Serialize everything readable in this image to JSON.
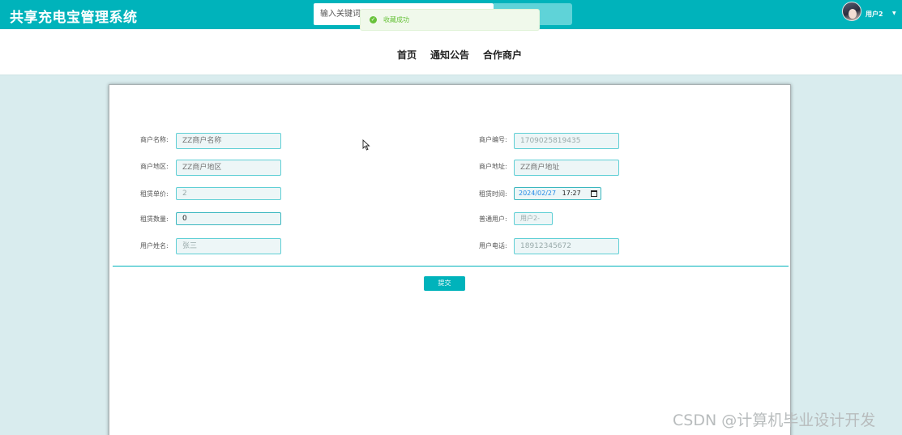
{
  "header": {
    "app_title": "共享充电宝管理系统",
    "search_placeholder": "输入关键词",
    "user_name": "用户2",
    "toast_message": "收藏成功"
  },
  "nav": {
    "items": [
      {
        "label": "首页"
      },
      {
        "label": "通知公告"
      },
      {
        "label": "合作商户"
      }
    ]
  },
  "form": {
    "merchant_name": {
      "label": "商户名称:",
      "placeholder": "ZZ商户名称"
    },
    "merchant_id": {
      "label": "商户编号:",
      "value": "1709025819435"
    },
    "merchant_region": {
      "label": "商户地区:",
      "placeholder": "ZZ商户地区"
    },
    "merchant_address": {
      "label": "商户地址:",
      "placeholder": "ZZ商户地址"
    },
    "unit_price": {
      "label": "租赁单价:",
      "value": "2"
    },
    "rental_time": {
      "label": "租赁时间:",
      "date": "2024/02/27",
      "time": "17:27"
    },
    "quantity": {
      "label": "租赁数量:",
      "value": "0"
    },
    "regular_user": {
      "label": "普通用户:",
      "value": "用户2-"
    },
    "user_full_name": {
      "label": "用户姓名:",
      "value": "张三"
    },
    "user_phone": {
      "label": "用户电话:",
      "value": "18912345672"
    },
    "submit_label": "提交"
  },
  "watermark": "CSDN @计算机毕业设计开发",
  "colors": {
    "accent": "#00b3bb",
    "toast_green": "#67c23a",
    "background": "#d9ecee"
  },
  "icons": [
    "success-check-icon",
    "caret-down-icon",
    "calendar-icon",
    "mouse-cursor-icon"
  ]
}
